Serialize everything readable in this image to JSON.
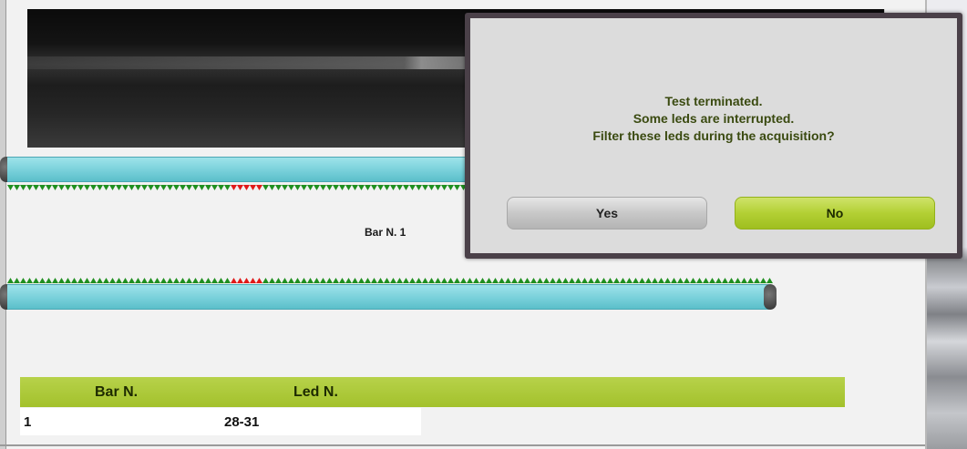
{
  "bar_label": "Bar N. 1",
  "table": {
    "headers": [
      "Bar N.",
      "Led N."
    ],
    "rows": [
      [
        "1",
        "28-31"
      ]
    ]
  },
  "dialog": {
    "lines": [
      "Test terminated.",
      "Some leds are interrupted.",
      "Filter these leds during the acquisition?"
    ],
    "yes_label": "Yes",
    "no_label": "No"
  },
  "leds": {
    "count": 120,
    "interrupted_top": [
      35,
      36,
      37,
      38,
      39
    ],
    "interrupted_bottom": [
      35,
      36,
      37,
      38,
      39
    ],
    "ok_color": "#1f8f1f",
    "interrupted_color": "#e01919"
  },
  "colors": {
    "accent_green": "#a3c12c",
    "bar_cyan": "#78d0da"
  }
}
